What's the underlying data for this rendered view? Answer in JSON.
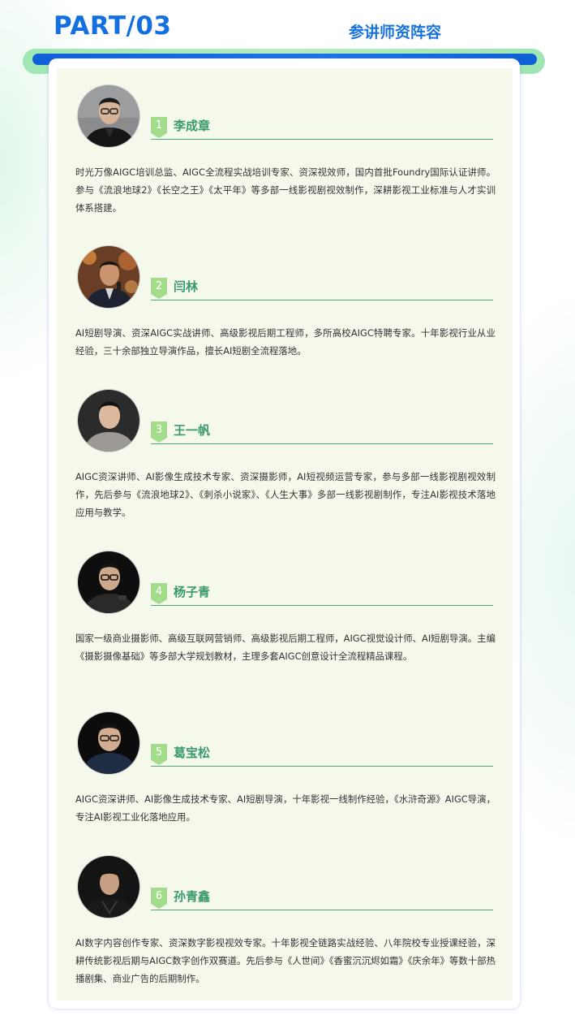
{
  "header": {
    "part": "PART/03",
    "title": "参讲师资阵容"
  },
  "colors": {
    "part_title": "#1470e0",
    "section_title": "#1a73dd",
    "bar_blue": "#1a6fe5",
    "bar_green": "#a8eabb",
    "card_bg": "#f4f9ec",
    "name": "#3a9a6a",
    "badge": "#a3dc8a",
    "rule": "#4ea67a"
  },
  "speakers": [
    {
      "number": "1",
      "name": "李成章",
      "bio": "时光万像AIGC培训总监、AIGC全流程实战培训专家、资深视效师，国内首批Foundry国际认证讲师。参与《流浪地球2》《长空之王》《太平年》等多部一线影视剧视效制作，深耕影视工业标准与人才实训体系搭建。"
    },
    {
      "number": "2",
      "name": "闫林",
      "bio": "AI短剧导演、资深AIGC实战讲师、高级影视后期工程师，多所高校AIGC特聘专家。十年影视行业从业经验，三十余部独立导演作品，擅长AI短剧全流程落地。"
    },
    {
      "number": "3",
      "name": "王一帆",
      "bio": "AIGC资深讲师、AI影像生成技术专家、资深摄影师，AI短视频运营专家，参与多部一线影视剧视效制作，先后参与《流浪地球2》、《刺杀小说家》、《人生大事》多部一线影视剧制作，专注AI影视技术落地应用与教学。"
    },
    {
      "number": "4",
      "name": "杨子青",
      "bio": "国家一级商业摄影师、高级互联网营销师、高级影视后期工程师，AIGC视觉设计师、AI短剧导演。主编《摄影摄像基础》等多部大学规划教材，主理多套AIGC创意设计全流程精品课程。"
    },
    {
      "number": "5",
      "name": "葛宝松",
      "bio": "AIGC资深讲师、AI影像生成技术专家、AI短剧导演，十年影视一线制作经验，《水浒奇源》AIGC导演，专注AI影视工业化落地应用。"
    },
    {
      "number": "6",
      "name": "孙青鑫",
      "bio": "AI数字内容创作专家、资深数字影视视效专家。十年影视全链路实战经验、八年院校专业授课经验，深耕传统影视后期与AIGC数字创作双赛道。先后参与《人世间》《香蜜沉沉烬如霜》《庆余年》等数十部热播剧集、商业广告的后期制作。"
    }
  ]
}
